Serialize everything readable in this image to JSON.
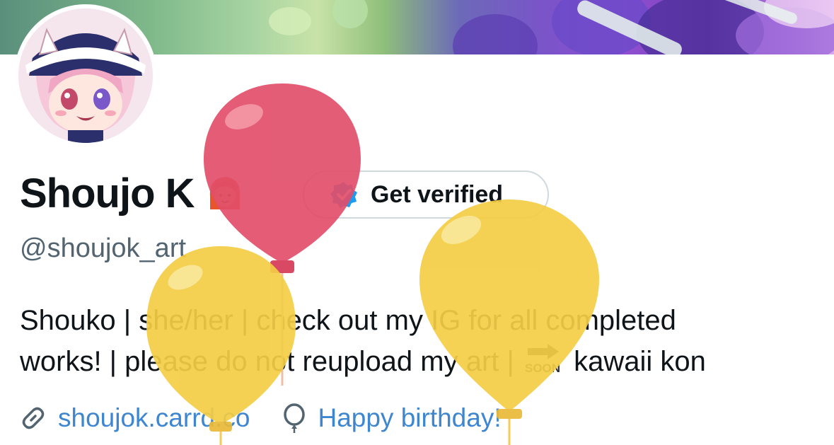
{
  "profile": {
    "display_name": "Shoujo K",
    "handle": "@shoujok_art",
    "emoji_icon": "girl-emoji-icon",
    "verify_button_label": "Get verified",
    "bio": {
      "line1": "Shouko | she/her | check out my IG for all completed",
      "line2_before": "works! | please do not reupload my art | ",
      "soon_icon": "soon-arrow-icon",
      "line2_after": " kawaii kon"
    },
    "website": "shoujok.carrd.co",
    "birthday_text": "Happy birthday!"
  },
  "colors": {
    "link": "#3e86d0",
    "handle": "#536471",
    "balloon_red": "#e0536d",
    "balloon_yellow": "#f3cd4a"
  }
}
